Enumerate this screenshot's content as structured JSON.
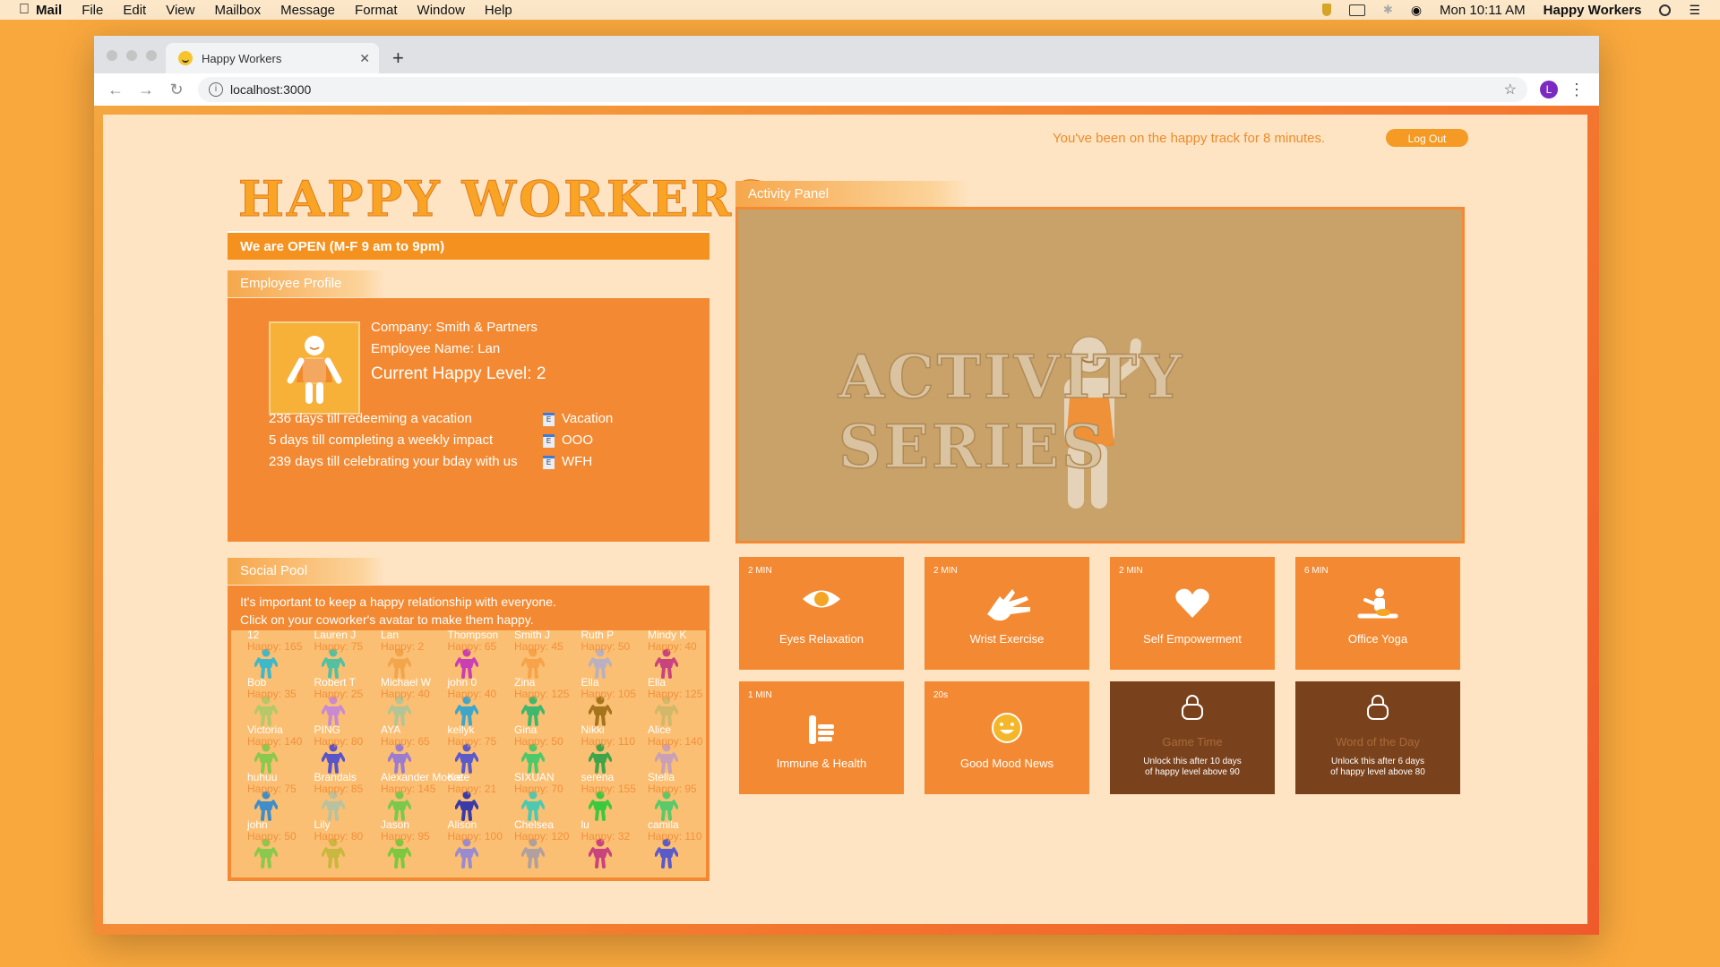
{
  "menubar": {
    "app": "Mail",
    "items": [
      "File",
      "Edit",
      "View",
      "Mailbox",
      "Message",
      "Format",
      "Window",
      "Help"
    ],
    "clock": "Mon 10:11 AM",
    "active_app": "Happy Workers"
  },
  "browser": {
    "tab_title": "Happy Workers",
    "url": "localhost:3000",
    "profile_initial": "L"
  },
  "header": {
    "track_text": "You've been on the happy track for 8 minutes.",
    "logout_label": "Log Out"
  },
  "brand": {
    "title": "HAPPY WORKERS",
    "open_text": "We are OPEN (M-F 9 am to 9pm)"
  },
  "profile": {
    "section_title": "Employee Profile",
    "company": "Company: Smith & Partners",
    "employee_name": "Employee Name: Lan",
    "happy_level": "Current Happy Level: 2",
    "countdowns": [
      {
        "text": "236 days till redeeming a vacation",
        "tag": "Vacation"
      },
      {
        "text": "5 days till completing a weekly impact",
        "tag": "OOO"
      },
      {
        "text": "239 days till celebrating your bday with us",
        "tag": "WFH"
      }
    ]
  },
  "social": {
    "section_title": "Social Pool",
    "line1": "It's important to keep a happy relationship with everyone.",
    "line2": "Click on your coworker's avatar to make them happy.",
    "coworkers": [
      {
        "name": "12",
        "happy": "Happy: 165",
        "color": "#3fb8c9"
      },
      {
        "name": "Lauren J",
        "happy": "Happy: 75",
        "color": "#54c0a2"
      },
      {
        "name": "Lan",
        "happy": "Happy: 2",
        "color": "#f2a54a"
      },
      {
        "name": "Thompson",
        "happy": "Happy: 65",
        "color": "#c93fb4"
      },
      {
        "name": "Smith J",
        "happy": "Happy: 45",
        "color": "#f6a34a"
      },
      {
        "name": "Ruth P",
        "happy": "Happy: 50",
        "color": "#b9b0c2"
      },
      {
        "name": "Mindy K",
        "happy": "Happy: 40",
        "color": "#c9447e"
      },
      {
        "name": "Bob",
        "happy": "Happy: 35",
        "color": "#b4c96a"
      },
      {
        "name": "Robert T",
        "happy": "Happy: 25",
        "color": "#c88bd1"
      },
      {
        "name": "Michael W",
        "happy": "Happy: 40",
        "color": "#b3c596"
      },
      {
        "name": "john 0",
        "happy": "Happy: 40",
        "color": "#3fa6c9"
      },
      {
        "name": "Zina",
        "happy": "Happy: 125",
        "color": "#3fb86d"
      },
      {
        "name": "Ella",
        "happy": "Happy: 105",
        "color": "#a6741c"
      },
      {
        "name": "Ella",
        "happy": "Happy: 125",
        "color": "#d1b86a"
      },
      {
        "name": "Victoria",
        "happy": "Happy: 140",
        "color": "#8ac94d"
      },
      {
        "name": "PING",
        "happy": "Happy: 80",
        "color": "#5a54c9"
      },
      {
        "name": "AYA",
        "happy": "Happy: 65",
        "color": "#9a7cd1"
      },
      {
        "name": "kellyk",
        "happy": "Happy: 75",
        "color": "#5b5ac9"
      },
      {
        "name": "Gina",
        "happy": "Happy: 50",
        "color": "#4dc96a"
      },
      {
        "name": "Nikki",
        "happy": "Happy: 110",
        "color": "#3fa44a"
      },
      {
        "name": "Alice",
        "happy": "Happy: 140",
        "color": "#c9a0b6"
      },
      {
        "name": "huhuu",
        "happy": "Happy: 75",
        "color": "#3f8ec9"
      },
      {
        "name": "Brandals",
        "happy": "Happy: 85",
        "color": "#b8c2a0"
      },
      {
        "name": "Alexander Moore",
        "happy": "Happy: 145",
        "color": "#7ac94d"
      },
      {
        "name": "Kate",
        "happy": "Happy: 21",
        "color": "#3a3aa8"
      },
      {
        "name": "SIXUAN",
        "happy": "Happy: 70",
        "color": "#4dc9b0"
      },
      {
        "name": "serena",
        "happy": "Happy: 155",
        "color": "#3cc93f"
      },
      {
        "name": "Stella",
        "happy": "Happy: 95",
        "color": "#5ac96a"
      },
      {
        "name": "john",
        "happy": "Happy: 50",
        "color": "#8ac94d"
      },
      {
        "name": "Lily",
        "happy": "Happy: 80",
        "color": "#c9b83f"
      },
      {
        "name": "Jason",
        "happy": "Happy: 95",
        "color": "#7ac93f"
      },
      {
        "name": "Alison",
        "happy": "Happy: 100",
        "color": "#9a8bd1"
      },
      {
        "name": "Chelsea",
        "happy": "Happy: 120",
        "color": "#b0a0a0"
      },
      {
        "name": "lu",
        "happy": "Happy: 32",
        "color": "#c9447e"
      },
      {
        "name": "camila",
        "happy": "Happy: 110",
        "color": "#5a5ac9"
      }
    ]
  },
  "activity": {
    "panel_title": "Activity Panel",
    "series_title": "ACTIVITY SERIES",
    "cards": [
      {
        "duration": "2 MIN",
        "label": "Eyes Relaxation",
        "icon": "eye-icon",
        "locked": false
      },
      {
        "duration": "2 MIN",
        "label": "Wrist Exercise",
        "icon": "hand-icon",
        "locked": false
      },
      {
        "duration": "2 MIN",
        "label": "Self Empowerment",
        "icon": "heart-icon",
        "locked": false
      },
      {
        "duration": "6 MIN",
        "label": "Office Yoga",
        "icon": "yoga-icon",
        "locked": false
      },
      {
        "duration": "1 MIN",
        "label": "Immune & Health",
        "icon": "thumbs-up-icon",
        "locked": false
      },
      {
        "duration": "20s",
        "label": "Good Mood News",
        "icon": "smiley-icon",
        "locked": false
      },
      {
        "duration": "",
        "label": "Game Time",
        "icon": "lock-icon",
        "locked": true,
        "unlock1": "Unlock this after 10 days",
        "unlock2": "of happy level above 90"
      },
      {
        "duration": "",
        "label": "Word of the Day",
        "icon": "lock-icon",
        "locked": true,
        "unlock1": "Unlock this after 6 days",
        "unlock2": "of happy level above 80"
      }
    ]
  }
}
